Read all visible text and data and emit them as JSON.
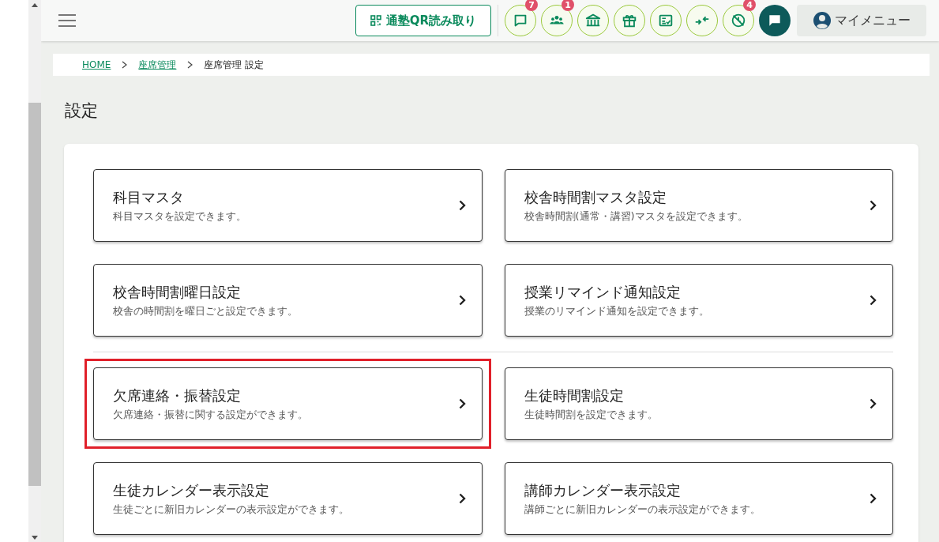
{
  "header": {
    "qr_button": "通塾QR読み取り",
    "badges": [
      {
        "count": "7"
      },
      {
        "count": "1"
      },
      {
        "count": "4"
      }
    ],
    "my_menu": "マイメニュー"
  },
  "breadcrumb": [
    {
      "label": "HOME",
      "link": true
    },
    {
      "label": "座席管理",
      "link": true
    },
    {
      "label": "座席管理 設定",
      "link": false
    }
  ],
  "page_title": "設定",
  "sections": [
    {
      "tiles": [
        {
          "title": "科目マスタ",
          "description": "科目マスタを設定できます。",
          "highlighted": false
        },
        {
          "title": "校舎時間割マスタ設定",
          "description": "校舎時間割(通常・講習)マスタを設定できます。",
          "highlighted": false
        },
        {
          "title": "校舎時間割曜日設定",
          "description": "校舎の時間割を曜日ごと設定できます。",
          "highlighted": false
        },
        {
          "title": "授業リマインド通知設定",
          "description": "授業のリマインド通知を設定できます。",
          "highlighted": false
        }
      ]
    },
    {
      "tiles": [
        {
          "title": "欠席連絡・振替設定",
          "description": "欠席連絡・振替に関する設定ができます。",
          "highlighted": true
        },
        {
          "title": "生徒時間割設定",
          "description": "生徒時間割を設定できます。",
          "highlighted": false
        },
        {
          "title": "生徒カレンダー表示設定",
          "description": "生徒ごとに新旧カレンダーの表示設定ができます。",
          "highlighted": false
        },
        {
          "title": "講師カレンダー表示設定",
          "description": "講師ごとに新旧カレンダーの表示設定ができます。",
          "highlighted": false
        }
      ]
    }
  ]
}
